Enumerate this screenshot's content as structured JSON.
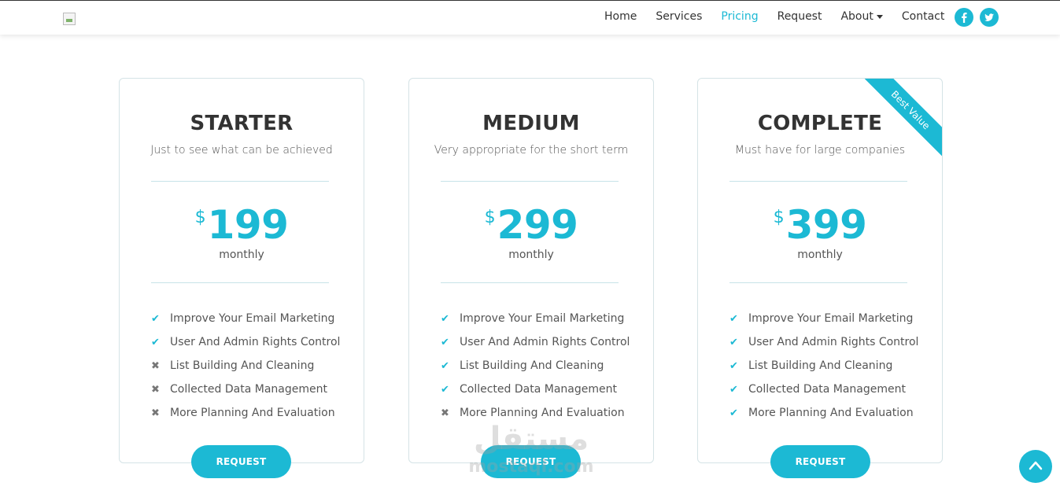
{
  "nav": {
    "items": [
      {
        "label": "Home",
        "active": false
      },
      {
        "label": "Services",
        "active": false
      },
      {
        "label": "Pricing",
        "active": true
      },
      {
        "label": "Request",
        "active": false
      },
      {
        "label": "About",
        "active": false,
        "has_dropdown": true
      },
      {
        "label": "Contact",
        "active": false
      }
    ],
    "social": [
      {
        "icon": "facebook-icon",
        "glyph": "f"
      },
      {
        "icon": "twitter-icon",
        "glyph": "t"
      }
    ]
  },
  "plans": [
    {
      "title": "STARTER",
      "subtitle": "Just to see what can be achieved",
      "currency": "$",
      "price": "199",
      "period": "monthly",
      "ribbon": "",
      "features": [
        {
          "label": "Improve Your Email Marketing",
          "included": true
        },
        {
          "label": "User And Admin Rights Control",
          "included": true
        },
        {
          "label": "List Building And Cleaning",
          "included": false
        },
        {
          "label": "Collected Data Management",
          "included": false
        },
        {
          "label": "More Planning And Evaluation",
          "included": false
        }
      ],
      "button": "REQUEST"
    },
    {
      "title": "MEDIUM",
      "subtitle": "Very appropriate for the short term",
      "currency": "$",
      "price": "299",
      "period": "monthly",
      "ribbon": "",
      "features": [
        {
          "label": "Improve Your Email Marketing",
          "included": true
        },
        {
          "label": "User And Admin Rights Control",
          "included": true
        },
        {
          "label": "List Building And Cleaning",
          "included": true
        },
        {
          "label": "Collected Data Management",
          "included": true
        },
        {
          "label": "More Planning And Evaluation",
          "included": false
        }
      ],
      "button": "REQUEST"
    },
    {
      "title": "COMPLETE",
      "subtitle": "Must have for large companies",
      "currency": "$",
      "price": "399",
      "period": "monthly",
      "ribbon": "Best Value",
      "features": [
        {
          "label": "Improve Your Email Marketing",
          "included": true
        },
        {
          "label": "User And Admin Rights Control",
          "included": true
        },
        {
          "label": "List Building And Cleaning",
          "included": true
        },
        {
          "label": "Collected Data Management",
          "included": true
        },
        {
          "label": "More Planning And Evaluation",
          "included": true
        }
      ],
      "button": "REQUEST"
    }
  ],
  "watermark": {
    "arabic": "مستقل",
    "latin": "mostaql.com"
  },
  "colors": {
    "accent": "#1cb9d4",
    "text": "#333333",
    "muted": "#555555",
    "border": "#d5e3e6"
  }
}
